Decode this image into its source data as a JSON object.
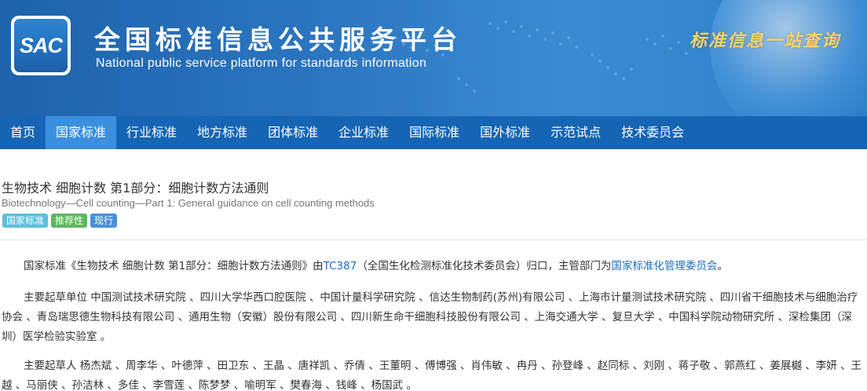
{
  "header": {
    "logo_text": "SAC",
    "title": "全国标准信息公共服务平台",
    "subtitle": "National public service platform  for standards information",
    "slogan": "标准信息一站查询"
  },
  "nav": {
    "items": [
      {
        "label": "首页",
        "active": false
      },
      {
        "label": "国家标准",
        "active": true
      },
      {
        "label": "行业标准",
        "active": false
      },
      {
        "label": "地方标准",
        "active": false
      },
      {
        "label": "团体标准",
        "active": false
      },
      {
        "label": "企业标准",
        "active": false
      },
      {
        "label": "国际标准",
        "active": false
      },
      {
        "label": "国外标准",
        "active": false
      },
      {
        "label": "示范试点",
        "active": false
      },
      {
        "label": "技术委员会",
        "active": false
      }
    ]
  },
  "standard": {
    "title": "生物技术 细胞计数 第1部分：细胞计数方法通则",
    "title_en": "Biotechnology—Cell counting—Part 1: General guidance on cell counting methods",
    "badges": [
      "国家标准",
      "推荐性",
      "现行"
    ],
    "summary": {
      "prefix": "国家标准《生物技术 细胞计数 第1部分：细胞计数方法通则》由",
      "tc_link": "TC387",
      "middle": "（全国生化检测标准化技术委员会）归口，主管部门为",
      "dept_link": "国家标准化管理委员会",
      "suffix": "。"
    },
    "drafting_units": "主要起草单位 中国测试技术研究院 、四川大学华西口腔医院 、中国计量科学研究院 、信达生物制药(苏州)有限公司 、上海市计量测试技术研究院 、四川省干细胞技术与细胞治疗协会 、青岛瑞思德生物科技有限公司 、通用生物（安徽）股份有限公司 、四川新生命干细胞科技股份有限公司 、上海交通大学 、复旦大学 、中国科学院动物研究所 、深检集团（深圳）医学检验实验室 。",
    "drafters": "主要起草人 杨杰斌 、周李华 、叶德萍 、田卫东 、王晶 、唐祥凯 、乔倩 、王董明 、傅博强 、肖伟敏 、冉丹 、孙登峰 、赵同标 、刘刚 、蒋子敬 、郭燕红 、姜展樾 、李妍 、王越 、马丽侠 、孙洁林 、多佳 、李雪莲 、陈梦梦 、喻明军 、樊春海 、钱峰 、杨国武 。"
  }
}
